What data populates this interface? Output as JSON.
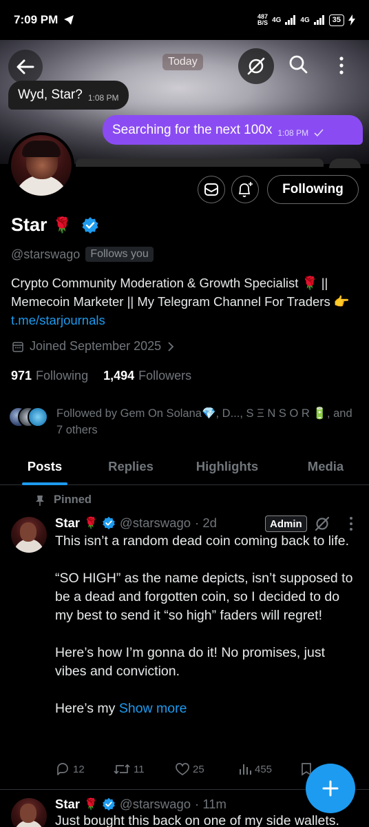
{
  "status_bar": {
    "time": "7:09 PM",
    "net_speed_value": "487",
    "net_speed_unit": "B/S",
    "sim1": "4G",
    "sim2": "4G",
    "battery": "35"
  },
  "chat_overlay": {
    "date_pill": "Today",
    "incoming_text": "Wyd, Star?",
    "incoming_time": "1:08 PM",
    "outgoing_text": "Searching for the next 100x",
    "outgoing_time": "1:08 PM"
  },
  "profile": {
    "name": "Star",
    "name_emoji": "🌹",
    "handle": "@starswago",
    "follows_you": "Follows you",
    "following_button": "Following",
    "bio_text": "Crypto Community Moderation & Growth Specialist 🌹 || Memecoin Marketer || My Telegram Channel For Traders 👉",
    "bio_link": "t.me/starjournals",
    "joined": "Joined September 2025",
    "following_count": "971",
    "following_label": "Following",
    "followers_count": "1,494",
    "followers_label": "Followers",
    "followed_by": "Followed by Gem On Solana💎, D..., S Ξ N S O R 🔋, and 7 others"
  },
  "tabs": [
    "Posts",
    "Replies",
    "Highlights",
    "Media"
  ],
  "pinned_post": {
    "pinned_label": "Pinned",
    "name": "Star",
    "name_emoji": "🌹",
    "handle": "@starswago",
    "time": "· 2d",
    "badge": "Admin",
    "paragraphs": [
      "This isn’t a random dead coin coming back to life.",
      "“SO HIGH” as the name depicts, isn’t supposed to be a dead and forgotten coin, so I decided to do my best to send it “so high” faders will regret!",
      "Here’s how I’m gonna do it! No promises, just vibes and conviction."
    ],
    "last_line": "Here’s my",
    "show_more": "Show more",
    "replies": "12",
    "reposts": "11",
    "likes": "25",
    "views": "455"
  },
  "second_post": {
    "name": "Star",
    "name_emoji": "🌹",
    "handle": "@starswago",
    "time": "· 11m",
    "text": "Just bought this back on one of my side wallets."
  },
  "colors": {
    "accent": "#1d9bf0",
    "outgoing_bubble": "#8a4cf2",
    "muted_text": "#71767b"
  }
}
